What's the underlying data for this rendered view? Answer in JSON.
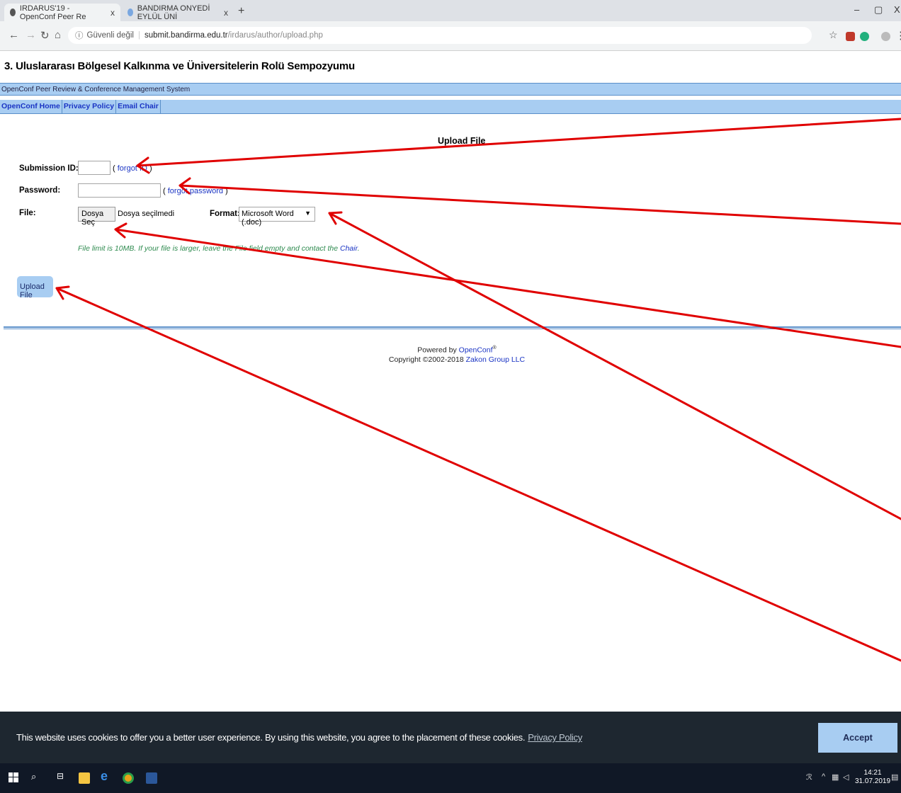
{
  "browser": {
    "tabs": [
      {
        "title": "IRDARUS'19 - OpenConf Peer Re"
      },
      {
        "title": "BANDIRMA ONYEDİ EYLÜL ÜNİ"
      }
    ],
    "tab_close": "x",
    "new_tab": "+",
    "security_label": "Güvenli değil",
    "url_host": "submit.bandirma.edu.tr",
    "url_path": "/irdarus/author/upload.php",
    "window_controls": [
      "–",
      "▢",
      "X"
    ]
  },
  "site": {
    "title": "3. Uluslararası Bölgesel Kalkınma ve Üniversitelerin Rolü Sempozyumu",
    "system_name": "OpenConf Peer Review & Conference Management System",
    "nav": [
      "OpenConf Home",
      "Privacy Policy",
      "Email Chair"
    ]
  },
  "form": {
    "heading": "Upload File",
    "submission_id_label": "Submission ID:",
    "forgot_id": "forgot ID",
    "password_label": "Password:",
    "forgot_password": "forgot password",
    "file_label": "File:",
    "choose_file_button": "Dosya Seç",
    "no_file_text": "Dosya seçilmedi",
    "format_label": "Format:",
    "format_selected": "Microsoft Word (.doc)",
    "note_text": "File limit is 10MB. If your file is larger, leave the File field empty and contact the ",
    "note_link": "Chair",
    "note_end": ".",
    "upload_button": "Upload File"
  },
  "footer": {
    "powered_by": "Powered by ",
    "openconf": "OpenConf",
    "copyright": "Copyright ©2002-2018 ",
    "company": "Zakon Group LLC"
  },
  "cookie_bar": {
    "message": "This website uses cookies to offer you a better user experience. By using this website, you agree to the placement of these cookies.",
    "privacy_link": "Privacy Policy",
    "accept_button": "Accept"
  },
  "taskbar": {
    "time": "14:21",
    "date": "31.07.2019"
  },
  "colors": {
    "bar_blue": "#a8cdf2",
    "link_blue": "#1a34c4",
    "annotation_red": "#e00000",
    "cookie_bg": "#1e2730"
  }
}
